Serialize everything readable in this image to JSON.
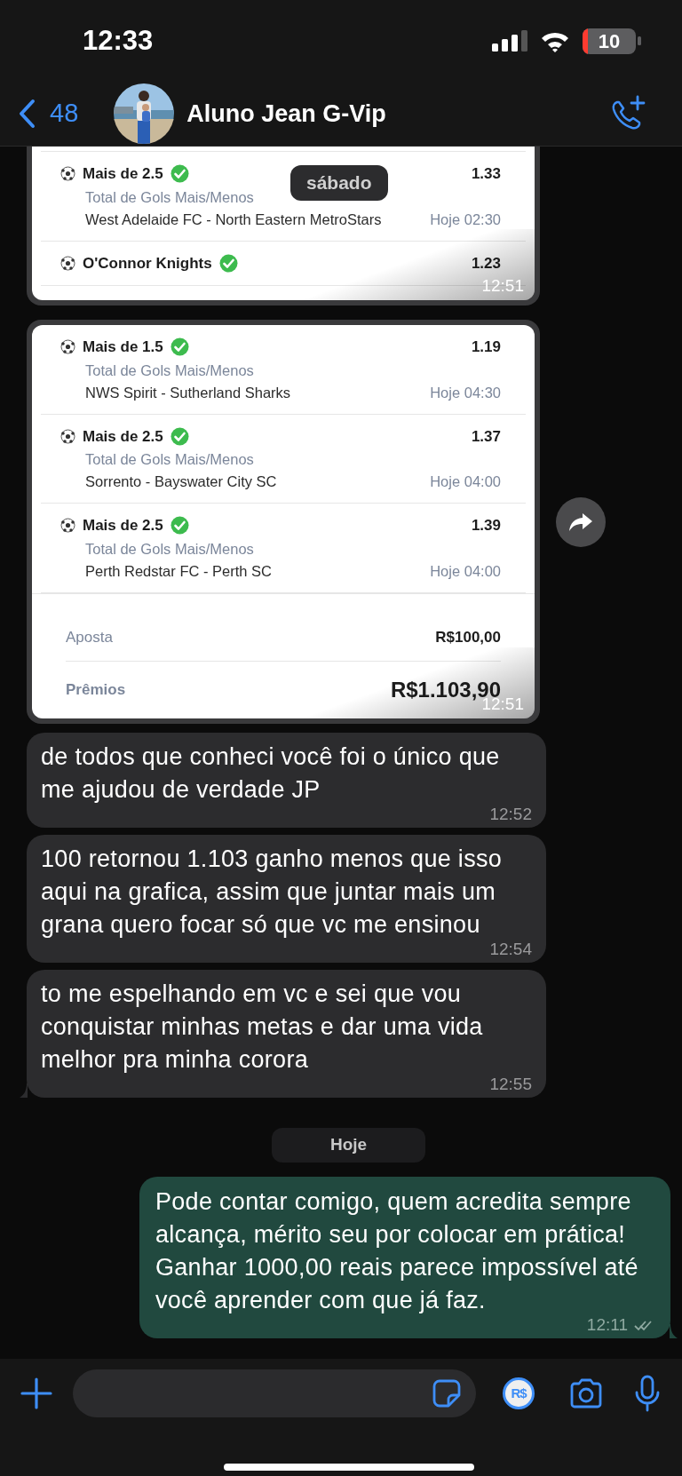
{
  "status_bar": {
    "time": "12:33",
    "battery": "10",
    "battery_low": true
  },
  "header": {
    "back_count": "48",
    "title": "Aluno Jean G-Vip"
  },
  "floating_date": "sábado",
  "messages": [
    {
      "outgoing": false,
      "time": "12:51",
      "forward": false,
      "tail": false,
      "bets": [
        {
          "title": "Mais de 2.5",
          "won": true,
          "odds": "1.33",
          "market": "Total de Gols Mais/Menos",
          "match": "West Adelaide FC - North Eastern MetroStars",
          "when": "Hoje 02:30"
        },
        {
          "title": "O'Connor Knights",
          "won": true,
          "odds": "1.23"
        }
      ]
    },
    {
      "outgoing": false,
      "time": "12:51",
      "forward": true,
      "tail": false,
      "bets": [
        {
          "title": "Mais de 1.5",
          "won": true,
          "odds": "1.19",
          "market": "Total de Gols Mais/Menos",
          "match": "NWS Spirit - Sutherland Sharks",
          "when": "Hoje 04:30"
        },
        {
          "title": "Mais de 2.5",
          "won": true,
          "odds": "1.37",
          "market": "Total de Gols Mais/Menos",
          "match": "Sorrento - Bayswater City SC",
          "when": "Hoje 04:00"
        },
        {
          "title": "Mais de 2.5",
          "won": true,
          "odds": "1.39",
          "market": "Total de Gols Mais/Menos",
          "match": "Perth Redstar FC - Perth SC",
          "when": "Hoje 04:00"
        }
      ],
      "summary": [
        {
          "label": "Aposta",
          "value": "R$100,00"
        },
        {
          "label": "Prêmios",
          "value": "R$1.103,90"
        }
      ]
    },
    {
      "kind": "text",
      "outgoing": false,
      "time": "12:52",
      "tail": false,
      "text": "de todos que conheci você foi o único que me ajudou de verdade JP"
    },
    {
      "kind": "text",
      "outgoing": false,
      "time": "12:54",
      "tail": false,
      "text": "100 retornou 1.103 ganho menos que isso aqui na grafica, assim que juntar mais um grana quero focar só que vc me ensinou"
    },
    {
      "kind": "text",
      "outgoing": false,
      "time": "12:55",
      "tail": true,
      "text": "to me espelhando em vc e sei que vou conquistar minhas metas e dar uma vida melhor pra minha corora"
    },
    {
      "kind": "date",
      "text": "Hoje"
    },
    {
      "kind": "text",
      "outgoing": true,
      "time": "12:11",
      "tail": true,
      "read": false,
      "text": "Pode contar comigo, quem acredita sempre alcança, mérito seu por colocar em prática! Ganhar 1000,00 reais parece impossível até você aprender com que já faz."
    }
  ],
  "composer": {
    "pay_label": "R$"
  }
}
